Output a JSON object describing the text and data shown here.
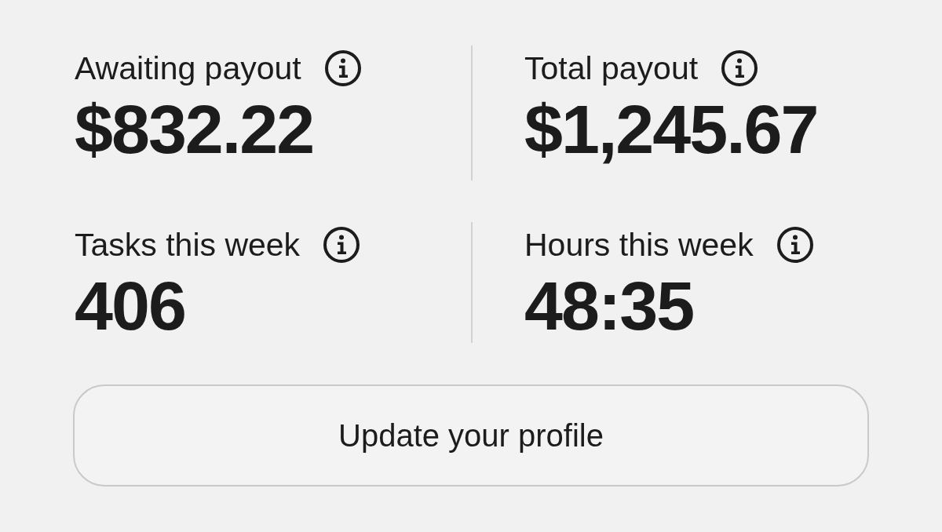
{
  "stats": [
    {
      "label": "Awaiting payout",
      "value": "$832.22"
    },
    {
      "label": "Total payout",
      "value": "$1,245.67"
    },
    {
      "label": "Tasks this week",
      "value": "406"
    },
    {
      "label": "Hours this week",
      "value": "48:35"
    }
  ],
  "button": {
    "label": "Update your profile"
  }
}
